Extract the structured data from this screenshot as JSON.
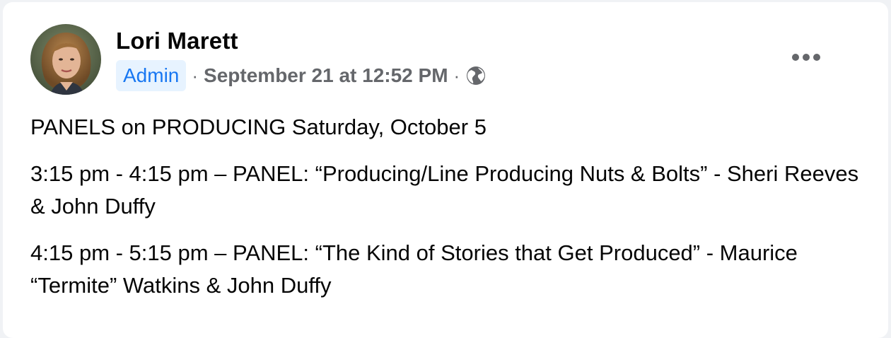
{
  "post": {
    "author": "Lori Marett",
    "role_badge": "Admin",
    "separator": "·",
    "timestamp": "September 21 at 12:52 PM",
    "privacy_icon": "globe-icon",
    "more_icon": "more-horizontal-icon",
    "paragraphs": [
      "PANELS on PRODUCING Saturday, October 5",
      "3:15 pm - 4:15 pm – PANEL: “Producing/Line Producing Nuts & Bolts” - Sheri Reeves & John Duffy",
      "4:15 pm - 5:15 pm – PANEL: “The Kind of Stories that Get Produced” - Maurice “Termite” Watkins & John Duffy"
    ]
  },
  "colors": {
    "page_background": "#f0f2f5",
    "card_background": "#ffffff",
    "text_primary": "#050505",
    "text_secondary": "#65676b",
    "badge_background": "#e7f3ff",
    "badge_text": "#1877f2"
  }
}
